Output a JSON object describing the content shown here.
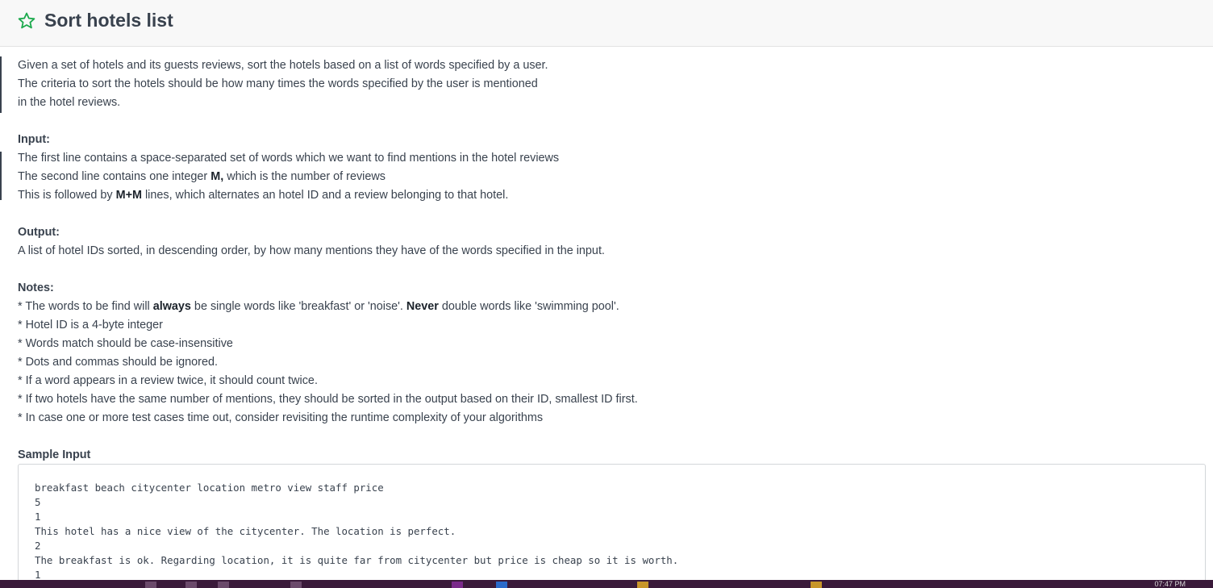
{
  "header": {
    "title": "Sort hotels list"
  },
  "description": {
    "intro": [
      "Given a set of hotels and its guests reviews, sort the hotels based on a list of words specified by a user.",
      "The criteria to sort the hotels should be how many times the words specified by the user is mentioned",
      "in the hotel reviews."
    ],
    "input_heading": "Input:",
    "input_line1": "The first line contains a space-separated set of words which we want to find mentions in the hotel reviews",
    "input_line2_pre": "The second line contains one integer ",
    "input_line2_bold": "M,",
    "input_line2_post": " which is the number of reviews",
    "input_line3_pre": "This is followed by ",
    "input_line3_bold": "M+M",
    "input_line3_post": " lines, which alternates an hotel ID and a review belonging to that hotel.",
    "output_heading": "Output:",
    "output_line": "A list of hotel IDs sorted, in descending order, by how many mentions they have of the words specified in the input.",
    "notes_heading": "Notes:",
    "note1_a": "* The words to be find will ",
    "note1_b": "always",
    "note1_c": " be single words like 'breakfast' or 'noise'. ",
    "note1_d": "Never",
    "note1_e": " double words like 'swimming pool'.",
    "notes": [
      "* Hotel ID is a 4-byte integer",
      "* Words match should be case-insensitive",
      "* Dots and commas should be ignored.",
      "* If a word appears in a review twice, it should count twice.",
      "* If two hotels have the same number of mentions, they should be sorted in the output based on their ID, smallest ID first.",
      "* In case one or more test cases time out, consider revisiting the runtime complexity of your algorithms"
    ],
    "sample_input_heading": "Sample Input"
  },
  "sample_input": [
    "breakfast beach citycenter location metro view staff price",
    "5",
    "1",
    "This hotel has a nice view of the citycenter. The location is perfect.",
    "2",
    "The breakfast is ok. Regarding location, it is quite far from citycenter but price is cheap so it is worth.",
    "1"
  ],
  "taskbar": {
    "clock": "07:47 PM"
  },
  "colors": {
    "accent_green": "#1ba94c",
    "text": "#39424e",
    "header_bg": "#f8f8f8",
    "taskbar_bg": "#3a1a3a"
  }
}
